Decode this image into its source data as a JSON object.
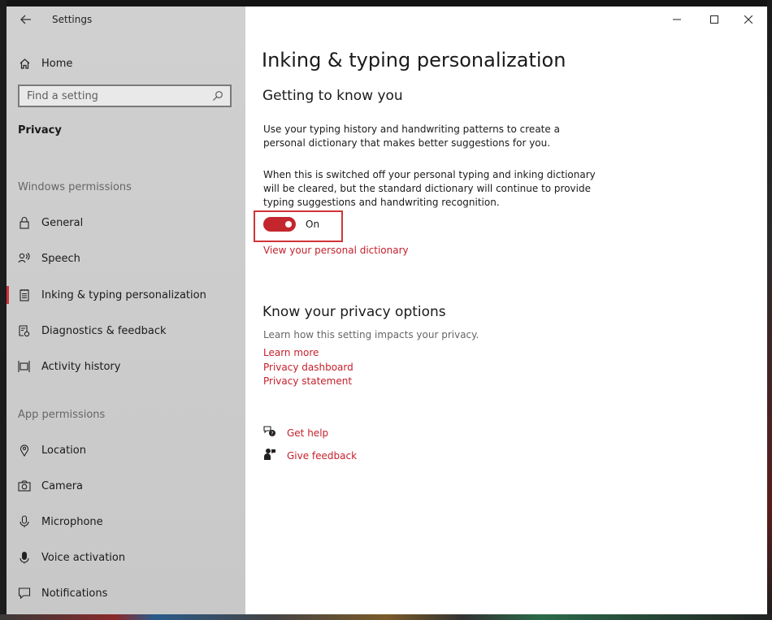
{
  "window": {
    "title": "Settings"
  },
  "sidebar": {
    "home_label": "Home",
    "search_placeholder": "Find a setting",
    "section_title": "Privacy",
    "windows_permissions_heading": "Windows permissions",
    "windows_permissions": [
      {
        "label": "General",
        "icon": "lock-icon"
      },
      {
        "label": "Speech",
        "icon": "speech-icon"
      },
      {
        "label": "Inking & typing personalization",
        "icon": "notepad-icon",
        "selected": true
      },
      {
        "label": "Diagnostics & feedback",
        "icon": "diagnostics-icon"
      },
      {
        "label": "Activity history",
        "icon": "timeline-icon"
      }
    ],
    "app_permissions_heading": "App permissions",
    "app_permissions": [
      {
        "label": "Location",
        "icon": "location-icon"
      },
      {
        "label": "Camera",
        "icon": "camera-icon"
      },
      {
        "label": "Microphone",
        "icon": "microphone-icon"
      },
      {
        "label": "Voice activation",
        "icon": "voice-icon"
      },
      {
        "label": "Notifications",
        "icon": "notification-icon"
      }
    ]
  },
  "main": {
    "title": "Inking & typing personalization",
    "getting_to_know": {
      "heading": "Getting to know you",
      "description": "Use your typing history and handwriting patterns to create a personal dictionary that makes better suggestions for you.",
      "note": "When this is switched off your personal typing and inking dictionary will be cleared, but the standard dictionary will continue to provide typing suggestions and handwriting recognition.",
      "toggle_state": "On",
      "toggle_on": true,
      "dictionary_link": "View your personal dictionary"
    },
    "privacy_options": {
      "heading": "Know your privacy options",
      "description": "Learn how this setting impacts your privacy.",
      "links": [
        "Learn more",
        "Privacy dashboard",
        "Privacy statement"
      ]
    },
    "help": {
      "get_help": "Get help",
      "give_feedback": "Give feedback"
    }
  },
  "colors": {
    "accent": "#c4262e",
    "sidebar_bg": "#cccccc",
    "highlight_box": "#d13438"
  }
}
